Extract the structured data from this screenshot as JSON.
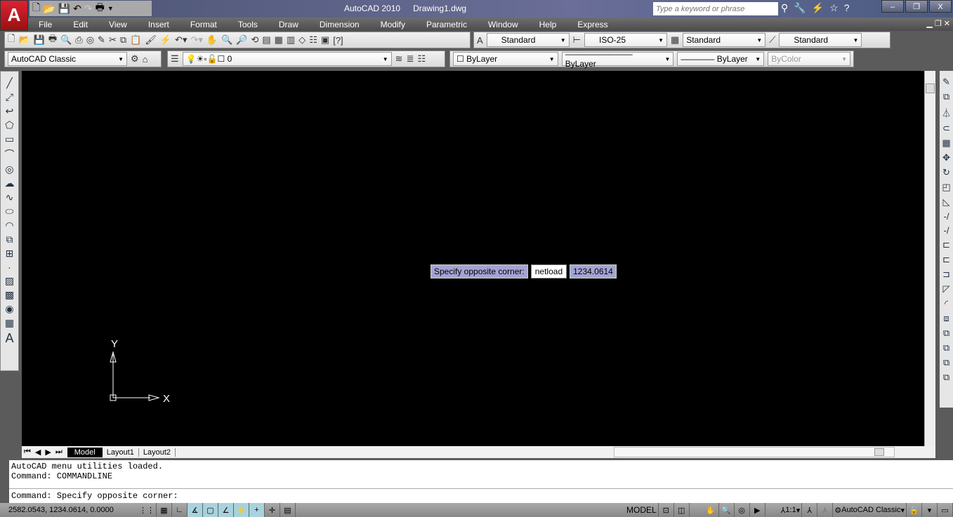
{
  "app": {
    "title": "AutoCAD 2010",
    "document": "Drawing1.dwg",
    "logo": "A"
  },
  "search": {
    "placeholder": "Type a keyword or phrase"
  },
  "menu": [
    "File",
    "Edit",
    "View",
    "Insert",
    "Format",
    "Tools",
    "Draw",
    "Dimension",
    "Modify",
    "Parametric",
    "Window",
    "Help",
    "Express"
  ],
  "styles": {
    "text_style": "Standard",
    "dim_style": "ISO-25",
    "table_style": "Standard",
    "mleader_style": "Standard"
  },
  "workspace": {
    "name": "AutoCAD Classic"
  },
  "layer": {
    "name": "0"
  },
  "properties": {
    "color": "ByLayer",
    "linetype": "ByLayer",
    "lineweight": "ByLayer",
    "plotstyle": "ByColor"
  },
  "tooltip": {
    "prompt": "Specify opposite corner:",
    "input": "netload",
    "value": "1234.0614"
  },
  "ucs": {
    "x": "X",
    "y": "Y"
  },
  "tabs": [
    "Model",
    "Layout1",
    "Layout2"
  ],
  "command": {
    "history": [
      "AutoCAD menu utilities loaded.",
      "Command: COMMANDLINE"
    ],
    "prompt": "Command: Specify opposite corner:"
  },
  "status": {
    "coords": "2582.0543, 1234.0614, 0.0000",
    "space": "MODEL",
    "annoscale": "1:1",
    "workspace": "AutoCAD Classic"
  },
  "colors": {
    "canvas": "#000000",
    "tooltip": "#a4a4d4",
    "active_toggle": "#a8d2dd"
  }
}
